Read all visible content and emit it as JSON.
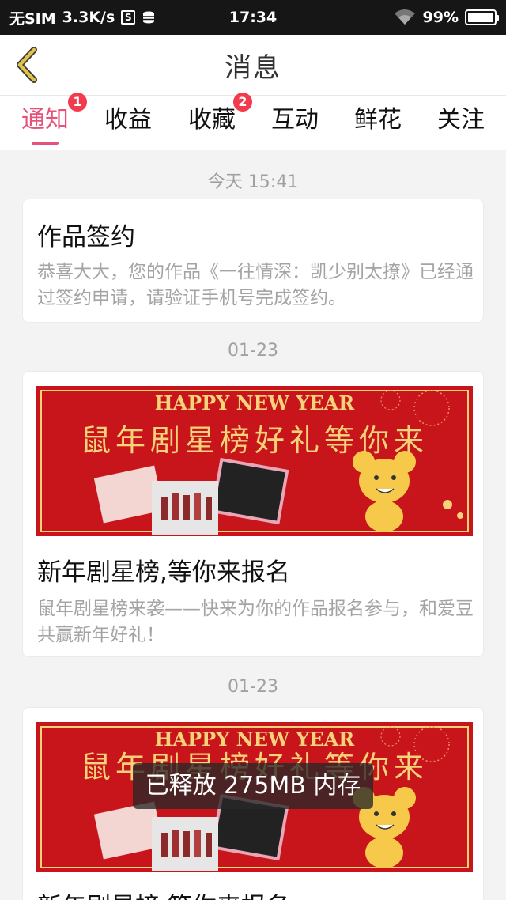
{
  "status_bar": {
    "carrier": "无SIM",
    "speed": "3.3K/s",
    "time": "17:34",
    "battery": "99%",
    "battery_level": 0.99
  },
  "header": {
    "title": "消息"
  },
  "tabs": [
    {
      "label": "通知",
      "badge": "1",
      "active": true
    },
    {
      "label": "收益",
      "badge": null,
      "active": false
    },
    {
      "label": "收藏",
      "badge": "2",
      "active": false
    },
    {
      "label": "互动",
      "badge": null,
      "active": false
    },
    {
      "label": "鲜花",
      "badge": null,
      "active": false
    },
    {
      "label": "关注",
      "badge": null,
      "active": false
    }
  ],
  "messages": [
    {
      "date": "今天 15:41",
      "title": "作品签约",
      "desc": "恭喜大大，您的作品《一往情深：凯少别太撩》已经通过签约申请，请验证手机号完成签约。"
    },
    {
      "date": "01-23",
      "banner_heading": "HAPPY NEW YEAR",
      "banner_text": "鼠年剧星榜好礼等你来",
      "title": "新年剧星榜,等你来报名",
      "desc": "鼠年剧星榜来袭——快来为你的作品报名参与，和爱豆共赢新年好礼！"
    },
    {
      "date": "01-23",
      "banner_heading": "HAPPY NEW YEAR",
      "banner_text": "鼠年剧星榜好礼等你来",
      "title": "新年剧星榜,等你来报名"
    }
  ],
  "toast": "已释放 275MB 内存",
  "colors": {
    "accent": "#e8527a",
    "badge": "#f23c4d",
    "banner_red": "#c8151b",
    "banner_gold": "#f6d27a",
    "back_arrow": "#e2c34a"
  }
}
